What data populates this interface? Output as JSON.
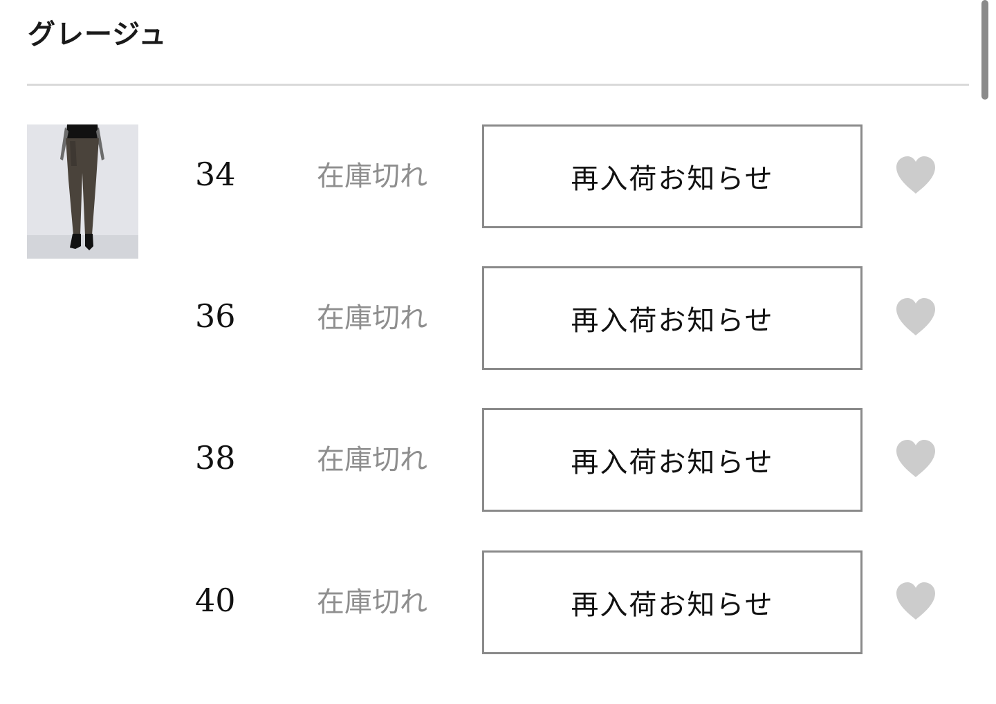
{
  "section": {
    "color_name": "グレージュ"
  },
  "product": {
    "thumbnail_alt": "product-photo"
  },
  "rows": [
    {
      "size": "34",
      "status": "在庫切れ",
      "button_label": "再入荷お知らせ",
      "favorite_icon": "heart-icon"
    },
    {
      "size": "36",
      "status": "在庫切れ",
      "button_label": "再入荷お知らせ",
      "favorite_icon": "heart-icon"
    },
    {
      "size": "38",
      "status": "在庫切れ",
      "button_label": "再入荷お知らせ",
      "favorite_icon": "heart-icon"
    },
    {
      "size": "40",
      "status": "在庫切れ",
      "button_label": "再入荷お知らせ",
      "favorite_icon": "heart-icon"
    }
  ],
  "colors": {
    "text": "#111111",
    "status_text": "#8e8e8e",
    "button_border": "#8a8a8a",
    "heart": "#cccccc",
    "divider": "#d9d9d9"
  }
}
